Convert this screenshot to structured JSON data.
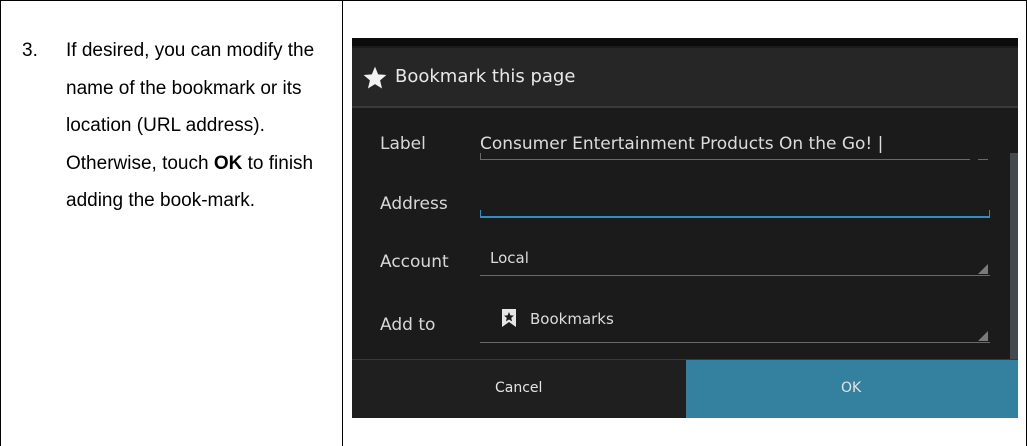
{
  "instructions": {
    "step_number": "3.",
    "text_before_ok": "If desired, you can modify the name of the bookmark or its location (URL address). Otherwise, touch ",
    "ok_emphasis": "OK",
    "text_after_ok": " to finish adding the book-mark."
  },
  "dialog": {
    "title": "Bookmark this page",
    "title_icon": "star-icon",
    "label_field": {
      "label": "Label",
      "value": "Consumer Entertainment Products On the Go! |"
    },
    "address_field": {
      "label": "Address",
      "value": ""
    },
    "account_field": {
      "label": "Account",
      "value": "Local"
    },
    "addto_field": {
      "label": "Add to",
      "value": "Bookmarks",
      "icon": "bookmark-star-icon"
    },
    "cancel_label": "Cancel",
    "ok_label": "OK"
  },
  "colors": {
    "dialog_background": "#1b1b1b",
    "ok_button": "#33809f",
    "focus_underline": "#2d8fc4"
  }
}
